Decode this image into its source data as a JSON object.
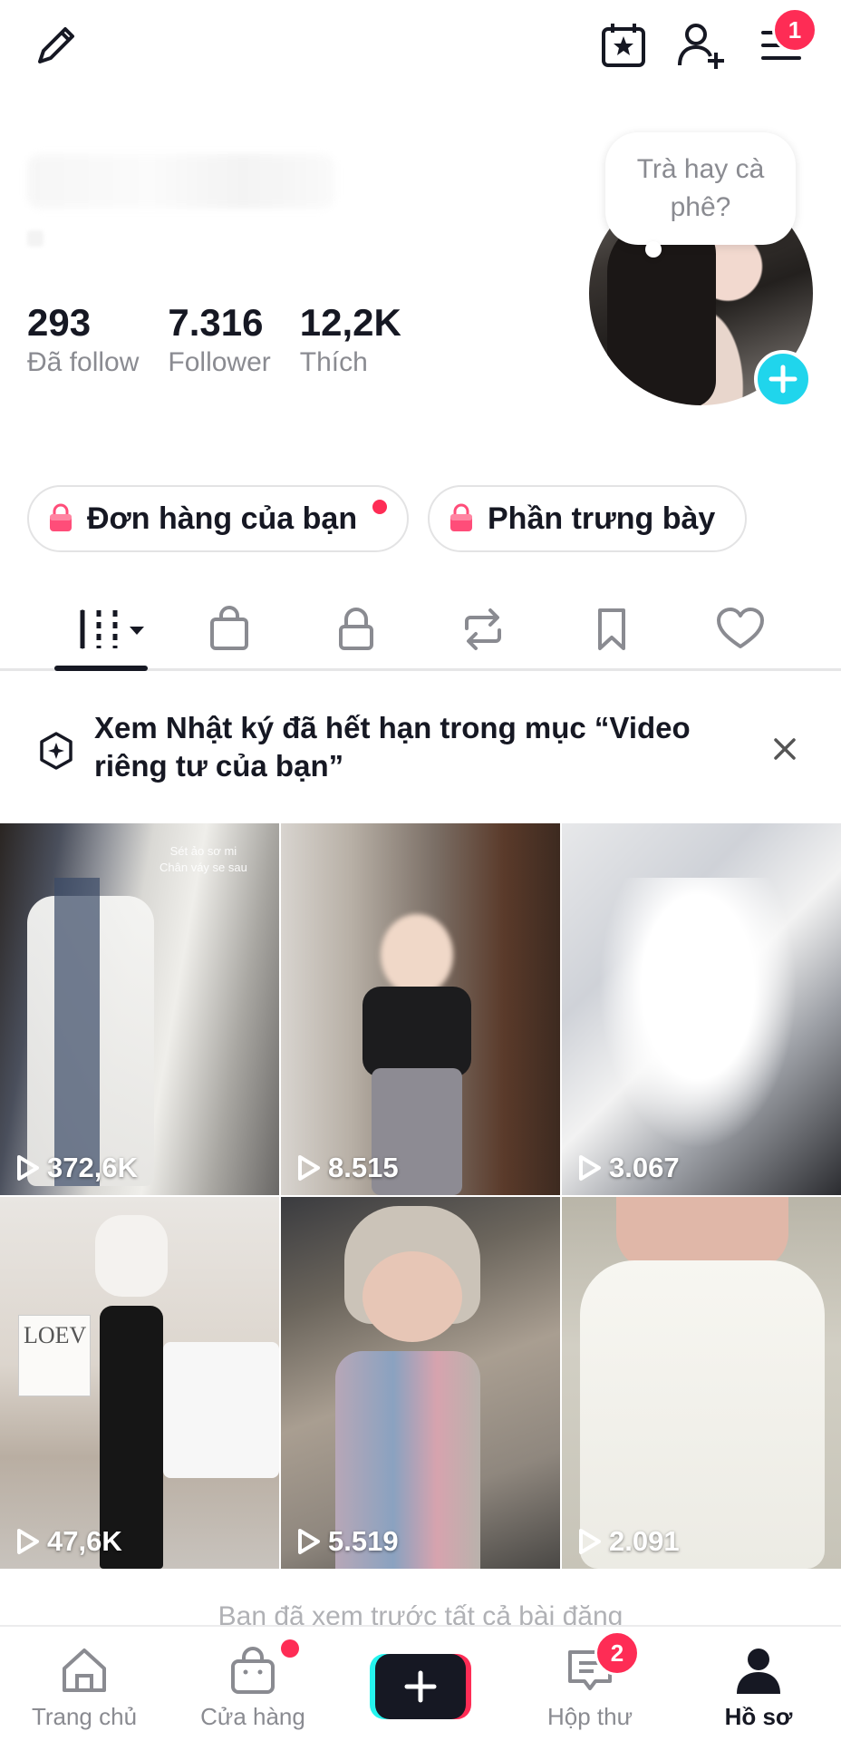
{
  "header": {
    "inbox_badge": "1"
  },
  "profile": {
    "stats": [
      {
        "value": "293",
        "label": "Đã follow"
      },
      {
        "value": "7.316",
        "label": "Follower"
      },
      {
        "value": "12,2K",
        "label": "Thích"
      }
    ],
    "bubble_text": "Trà hay cà phê?"
  },
  "actions": {
    "orders_label": "Đơn hàng của bạn",
    "showcase_label": "Phần trưng bày"
  },
  "notice": {
    "text": "Xem Nhật ký đã hết hạn trong mục “Video riêng tư của bạn”"
  },
  "videos": [
    {
      "views": "372,6K",
      "caption": "Sét ảo sơ mi\nChân váy se sau"
    },
    {
      "views": "8.515"
    },
    {
      "views": "3.067"
    },
    {
      "views": "47,6K",
      "caption": "LOEV"
    },
    {
      "views": "5.519"
    },
    {
      "views": "2.091"
    }
  ],
  "footer_text": "Bạn đã xem trước tất cả bài đăng",
  "bottom_nav": {
    "home": "Trang chủ",
    "shop": "Cửa hàng",
    "inbox": "Hộp thư",
    "inbox_badge": "2",
    "profile": "Hồ sơ"
  },
  "colors": {
    "accent_red": "#fe2c55",
    "accent_cyan": "#20d5ec",
    "text_primary": "#161823",
    "text_secondary": "#8a8b91"
  }
}
